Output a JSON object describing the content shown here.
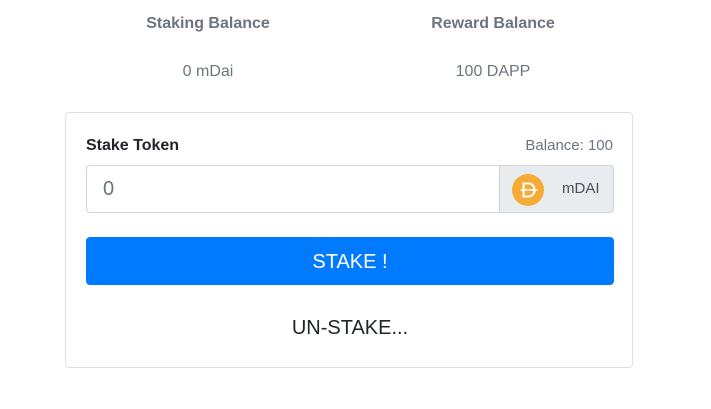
{
  "balances": {
    "staking": {
      "title": "Staking Balance",
      "value": "0 mDai"
    },
    "reward": {
      "title": "Reward Balance",
      "value": "100 DAPP"
    }
  },
  "form": {
    "stake_label": "Stake Token",
    "balance_label": "Balance: 100",
    "amount_placeholder": "0",
    "token_symbol": "mDAI",
    "token_icon": "dai-coin-icon",
    "stake_button": "STAKE !",
    "unstake_button": "UN-STAKE..."
  },
  "colors": {
    "primary": "#007bff",
    "dai_gold": "#f5ac37"
  }
}
